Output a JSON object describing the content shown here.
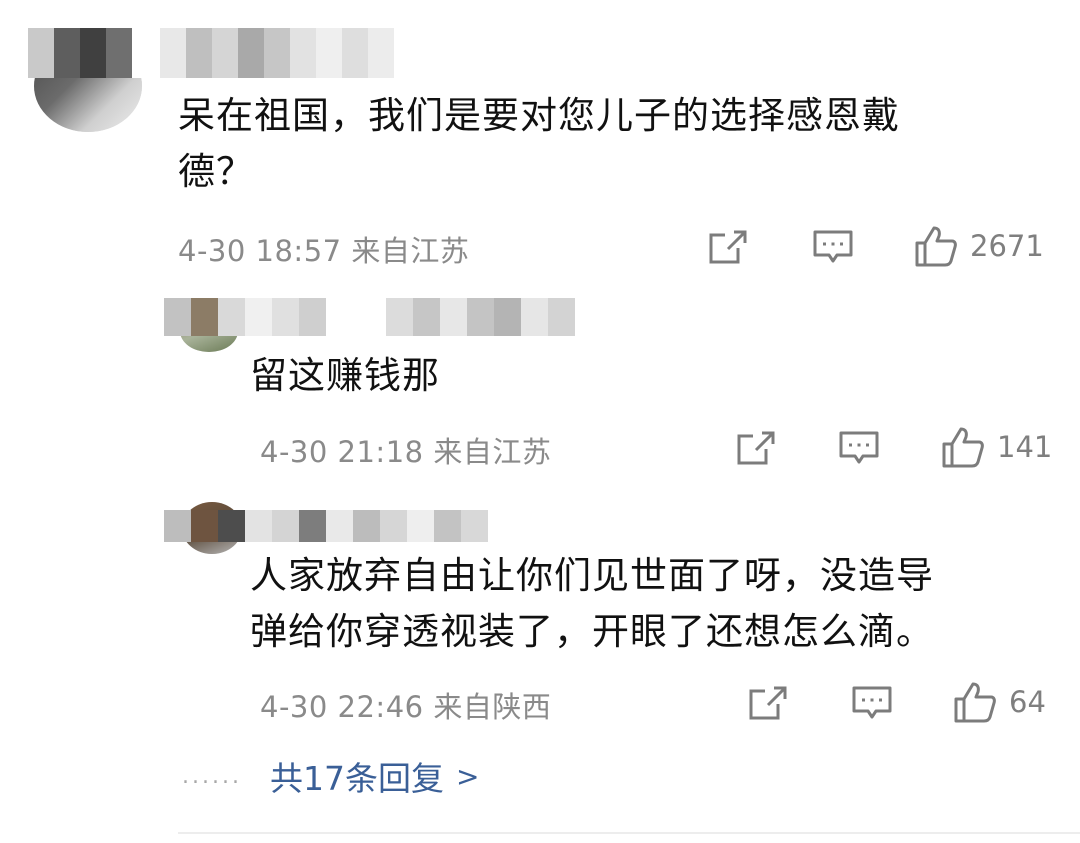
{
  "comments": [
    {
      "text": "呆在祖国，我们是要对您儿子的选择感恩戴德？",
      "line1": "呆在祖国，我们是要对您儿子的选择感恩戴",
      "line2": "德？",
      "meta": "4-30 18:57 来自江苏",
      "likes": "2671"
    }
  ],
  "replies": [
    {
      "text": "留这赚钱那",
      "meta": "4-30 21:18 来自江苏",
      "likes": "141"
    },
    {
      "text": "人家放弃自由让你们见世面了呀，没造导弹给你穿透视装了，开眼了还想怎么滴。",
      "line1": "人家放弃自由让你们见世面了呀，没造导",
      "line2": "弹给你穿透视装了，开眼了还想怎么滴。",
      "meta": "4-30 22:46 来自陕西",
      "likes": "64"
    }
  ],
  "more_replies": {
    "dots": "......",
    "label": "共17条回复",
    "chevron": ">"
  },
  "icons": {
    "share": "share-icon",
    "comment": "comment-icon",
    "like": "thumbs-up-icon"
  },
  "colors": {
    "text": "#111111",
    "meta": "#8a8a8a",
    "link": "#3a5f97"
  }
}
